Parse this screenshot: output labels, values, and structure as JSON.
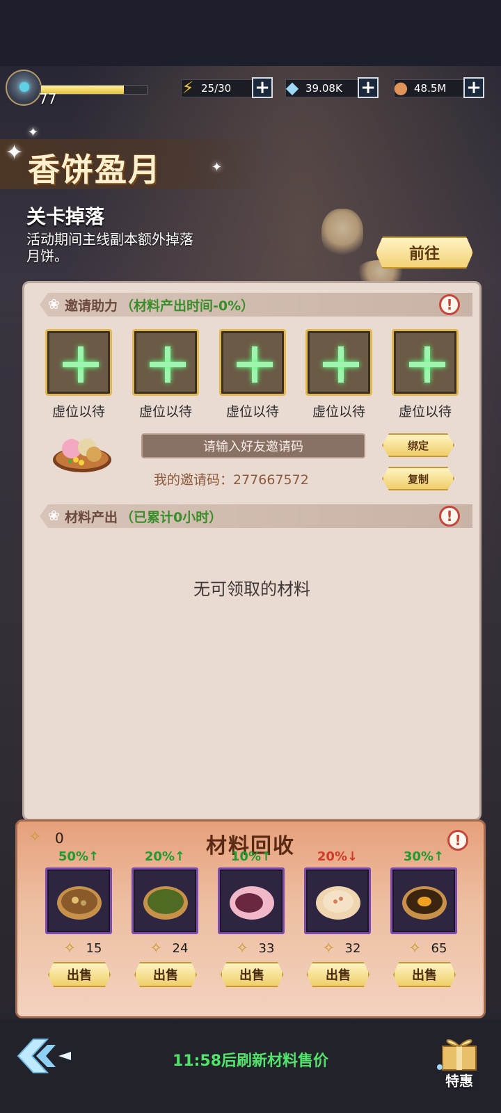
{
  "status": {
    "level": "77",
    "xp_fraction": 0.78,
    "stamina": "25/30",
    "diamonds": "39.08K",
    "coins": "48.5M"
  },
  "event": {
    "title": "香饼盈月",
    "section_heading": "关卡掉落",
    "section_desc": "活动期间主线副本额外掉落月饼。",
    "goto_label": "前往"
  },
  "invite": {
    "header_label": "邀请助力",
    "header_highlight": "（材料产出时间-0%）",
    "slots": [
      {
        "label": "虚位以待"
      },
      {
        "label": "虚位以待"
      },
      {
        "label": "虚位以待"
      },
      {
        "label": "虚位以待"
      },
      {
        "label": "虚位以待"
      }
    ],
    "input_placeholder": "请输入好友邀请码",
    "bind_label": "绑定",
    "copy_label": "复制",
    "my_code": "我的邀请码：277667572"
  },
  "output": {
    "header_label": "材料产出",
    "header_highlight": "（已累计0小时）",
    "empty_message": "无可领取的材料"
  },
  "recycle": {
    "title": "材料回收",
    "token_count": "0",
    "items": [
      {
        "pct": "50%↑",
        "direction": "up",
        "price": "15",
        "sell_label": "出售"
      },
      {
        "pct": "20%↑",
        "direction": "up",
        "price": "24",
        "sell_label": "出售"
      },
      {
        "pct": "10%↑",
        "direction": "up",
        "price": "33",
        "sell_label": "出售"
      },
      {
        "pct": "20%↓",
        "direction": "down",
        "price": "32",
        "sell_label": "出售"
      },
      {
        "pct": "30%↑",
        "direction": "up",
        "price": "65",
        "sell_label": "出售"
      }
    ]
  },
  "bottom": {
    "refresh_text": "11:58后刷新材料售价",
    "special_label": "特惠"
  },
  "colors": {
    "accent_gold": "#e1b850",
    "up_green": "#1e9a30",
    "down_red": "#d33a2a",
    "refresh_green": "#52e36a"
  }
}
